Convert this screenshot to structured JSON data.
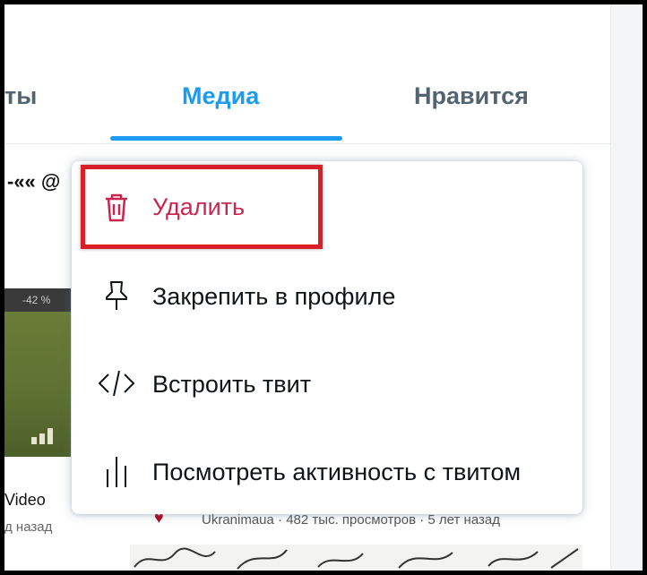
{
  "tabs": {
    "items": [
      {
        "label": "ты"
      },
      {
        "label": "Медиа"
      },
      {
        "label": "Нравится"
      }
    ],
    "active_index": 1
  },
  "background": {
    "name_fragment": "-««  @",
    "image_overlay_text": "-42 %",
    "video_title_fragment": "Video",
    "ago_fragment": "д назад",
    "channel": "Ukranimaua",
    "views": "482 тыс. просмотров",
    "age": "5 лет назад"
  },
  "menu": {
    "items": [
      {
        "label": "Удалить",
        "icon": "trash-icon",
        "color": "#c8264f"
      },
      {
        "label": "Закрепить в профиле",
        "icon": "pin-icon"
      },
      {
        "label": "Встроить твит",
        "icon": "code-icon"
      },
      {
        "label": "Посмотреть активность с твитом",
        "icon": "analytics-icon"
      }
    ]
  },
  "colors": {
    "accent": "#1d9bf0",
    "danger": "#c8264f",
    "highlight_border": "#d81f27"
  }
}
